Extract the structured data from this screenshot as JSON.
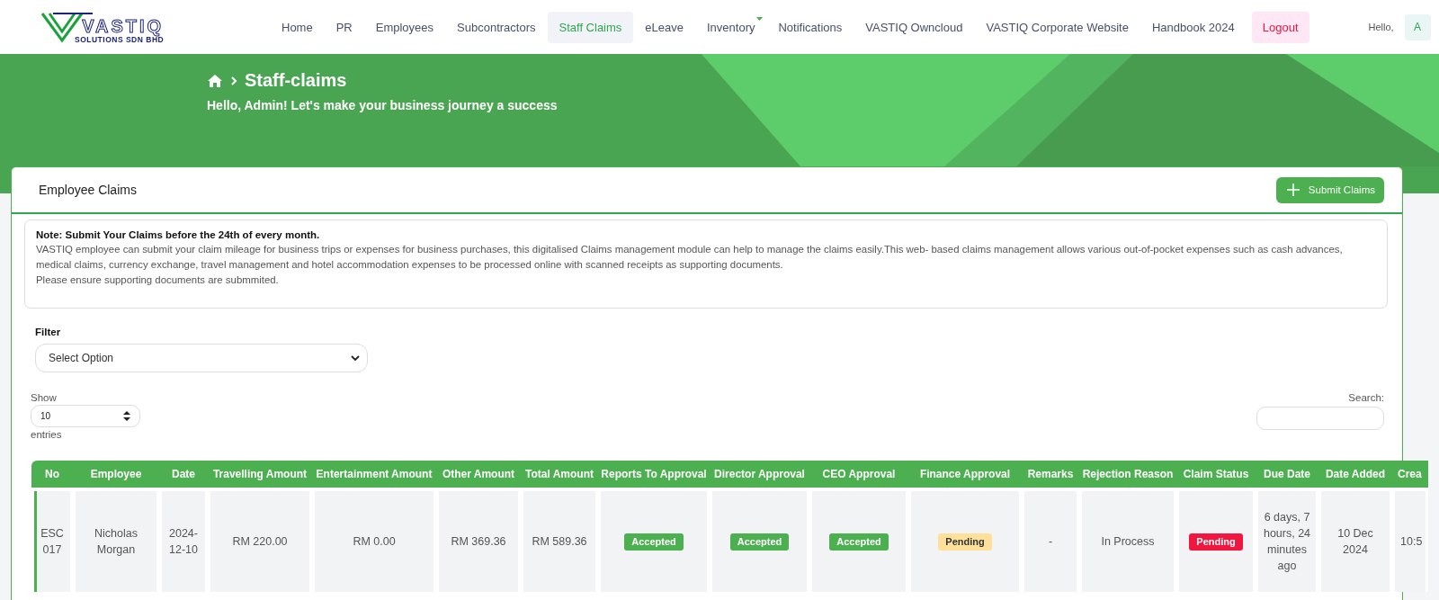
{
  "logo": {
    "name": "VASTIQ",
    "subtitle": "SOLUTIONS SDN BHD"
  },
  "nav": [
    {
      "label": "Home",
      "selected": false,
      "kind": "link"
    },
    {
      "label": "PR",
      "selected": false,
      "kind": "link"
    },
    {
      "label": "Employees",
      "selected": false,
      "kind": "link"
    },
    {
      "label": "Subcontractors",
      "selected": false,
      "kind": "link"
    },
    {
      "label": "Staff Claims",
      "selected": true,
      "kind": "link"
    },
    {
      "label": "eLeave",
      "selected": false,
      "kind": "link"
    },
    {
      "label": "Inventory",
      "selected": false,
      "kind": "dropdown"
    },
    {
      "label": "Notifications",
      "selected": false,
      "kind": "link"
    },
    {
      "label": "VASTIQ Owncloud",
      "selected": false,
      "kind": "link"
    },
    {
      "label": "VASTIQ Corporate Website",
      "selected": false,
      "kind": "link"
    },
    {
      "label": "Handbook 2024",
      "selected": false,
      "kind": "link"
    },
    {
      "label": "Logout",
      "selected": false,
      "kind": "logout"
    }
  ],
  "user": {
    "greeting": "Hello,",
    "avatar": "A"
  },
  "hero": {
    "title": "Staff-claims",
    "subtitle": "Hello, Admin! Let's make your business journey a success"
  },
  "card": {
    "title": "Employee Claims",
    "button": "Submit Claims",
    "note": {
      "heading": "Note: Submit Your Claims before the 24th of every month.",
      "body": "VASTIQ employee can submit your claim mileage for business trips or expenses for business purchases, this digitalised Claims management module can help to manage the claims easily.This web- based claims management allows various out-of-pocket expenses such as cash advances, medical claims, currency exchange, travel management and hotel accommodation expenses to be processed online with scanned receipts as supporting documents.",
      "footer": "Please ensure supporting documents are submmited."
    },
    "filter": {
      "label": "Filter",
      "value": "Select Option"
    },
    "length": {
      "show": "Show",
      "value": "10",
      "entries": "entries"
    },
    "search": {
      "label": "Search:"
    }
  },
  "table": {
    "columns": [
      "No",
      "Employee",
      "Date",
      "Travelling Amount",
      "Entertainment Amount",
      "Other Amount",
      "Total Amount",
      "Reports To Approval",
      "Director Approval",
      "CEO Approval",
      "Finance Approval",
      "Remarks",
      "Rejection Reason",
      "Claim Status",
      "Due Date",
      "Date Added",
      "Crea"
    ],
    "rows": [
      {
        "selected": true,
        "cells": [
          {
            "kind": "text",
            "text": "ESC 017"
          },
          {
            "kind": "text",
            "text": "Nicholas Morgan"
          },
          {
            "kind": "text",
            "text": "2024-12-10"
          },
          {
            "kind": "text",
            "text": "RM 220.00"
          },
          {
            "kind": "text",
            "text": "RM 0.00"
          },
          {
            "kind": "text",
            "text": "RM 369.36"
          },
          {
            "kind": "text",
            "text": "RM 589.36"
          },
          {
            "kind": "badge",
            "text": "Accepted",
            "color": "#4caf50"
          },
          {
            "kind": "badge",
            "text": "Accepted",
            "color": "#4caf50"
          },
          {
            "kind": "badge",
            "text": "Accepted",
            "color": "#4caf50"
          },
          {
            "kind": "badge",
            "text": "Pending",
            "color": "#ffe09a"
          },
          {
            "kind": "text",
            "text": "-"
          },
          {
            "kind": "text",
            "text": "In Process"
          },
          {
            "kind": "badge",
            "text": "Pending",
            "color": "#f0163f"
          },
          {
            "kind": "text",
            "text": "6 days, 7 hours, 24 minutes ago"
          },
          {
            "kind": "text",
            "text": "10 Dec 2024"
          },
          {
            "kind": "text",
            "text": "10:5"
          }
        ]
      }
    ]
  }
}
